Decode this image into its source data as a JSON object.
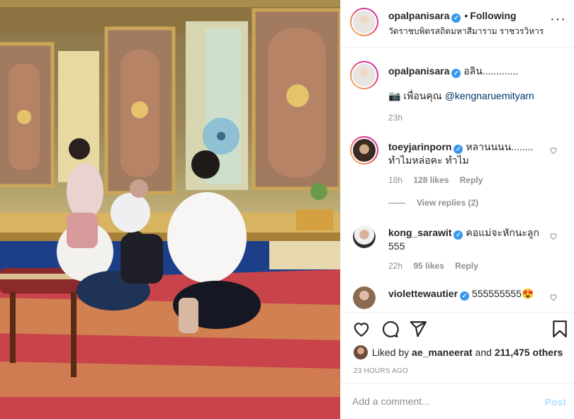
{
  "post": {
    "image_alt": "Family kneeling in prayer in an ornate Thai temple hall",
    "author": "opalpanisara",
    "separator": "•",
    "follow_label": "Following",
    "location": "วัดราชบพิตรสถิตมหาสีมาราม ราชวรวิหาร",
    "more_icon": "more-horizontal-icon"
  },
  "caption": {
    "username": "opalpanisara",
    "text": "อลิน.............",
    "tag_prefix": "📷 เพื่อนคุณ ",
    "tag_mention": "@kengnaruemityarn",
    "age": "23h"
  },
  "comments": [
    {
      "username": "toeyjarinporn",
      "text_line1": "หลานนนน........",
      "text_line2": "ทำไมหล่อคะ ทำไม",
      "age": "18h",
      "likes": "128 likes",
      "reply_label": "Reply"
    },
    {
      "username": "kong_sarawit",
      "text_line1": "คอแม่จะหักนะลูก",
      "text_line2": "555",
      "age": "22h",
      "likes": "95 likes",
      "reply_label": "Reply"
    },
    {
      "username": "violettewautier",
      "text_line1": "555555555",
      "emoji": "😍"
    }
  ],
  "view_replies_label": "View replies (2)",
  "liked_by": {
    "prefix": "Liked by ",
    "user": "ae_maneerat",
    "middle": " and ",
    "count": "211,475 others"
  },
  "timestamp": "23 HOURS AGO",
  "composer": {
    "placeholder": "Add a comment...",
    "post_label": "Post"
  },
  "colors": {
    "link": "#00376b",
    "verified": "#3897f0",
    "post_disabled": "#b2dffc",
    "muted": "#8e8e8e"
  }
}
